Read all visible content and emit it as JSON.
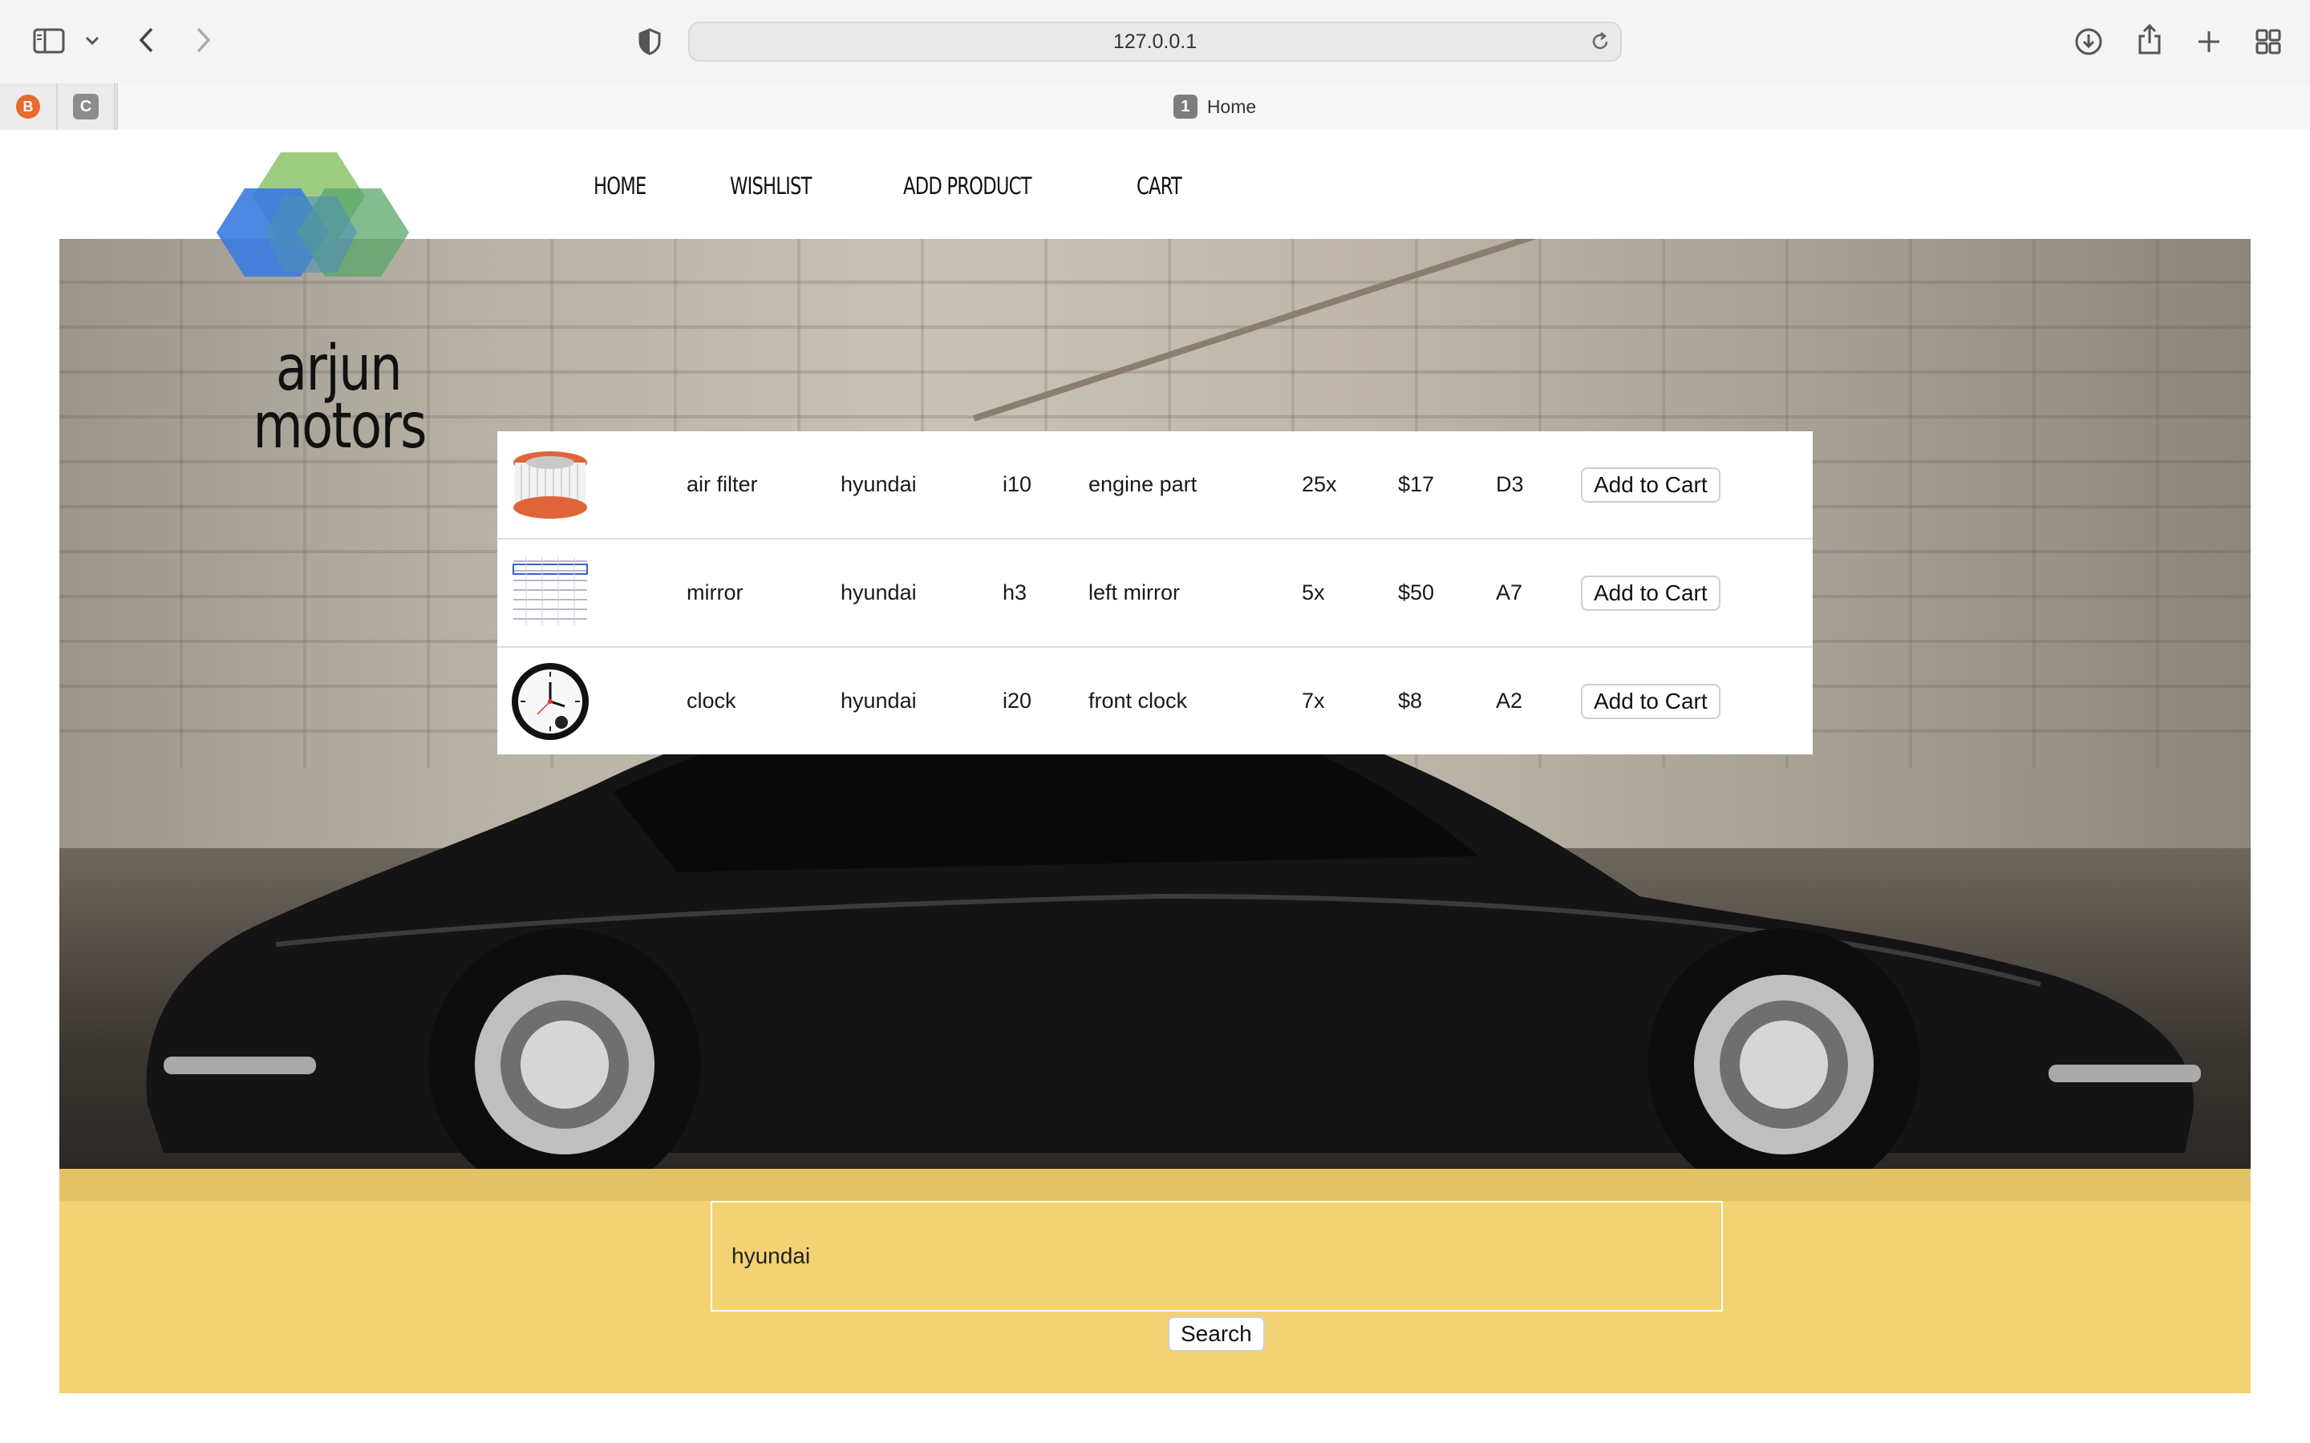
{
  "browser": {
    "url": "127.0.0.1",
    "tab": {
      "badge": "1",
      "title": "Home"
    },
    "pinned_tabs": [
      {
        "letter": "B",
        "color": "#e9692c"
      },
      {
        "letter": "C",
        "color": "#8c8c8c"
      }
    ]
  },
  "nav": {
    "items": [
      "HOME",
      "WISHLIST",
      "ADD PRODUCT",
      "CART"
    ]
  },
  "logo": {
    "line1": "arjun",
    "line2": "motors"
  },
  "products": [
    {
      "name": "air filter",
      "brand": "hyundai",
      "model": "i10",
      "category": "engine part",
      "qty": "25x",
      "price": "$17",
      "location": "D3",
      "action": "Add to Cart",
      "image": "air-filter-image"
    },
    {
      "name": "mirror",
      "brand": "hyundai",
      "model": "h3",
      "category": "left mirror",
      "qty": "5x",
      "price": "$50",
      "location": "A7",
      "action": "Add to Cart",
      "image": "mirror-image"
    },
    {
      "name": "clock",
      "brand": "hyundai",
      "model": "i20",
      "category": "front clock",
      "qty": "7x",
      "price": "$8",
      "location": "A2",
      "action": "Add to Cart",
      "image": "clock-image"
    }
  ],
  "search": {
    "value": "hyundai",
    "button": "Search"
  },
  "colors": {
    "search_band": "#f2d272",
    "logo_blue": "#3a7be0",
    "logo_green": "#8cc26a"
  }
}
